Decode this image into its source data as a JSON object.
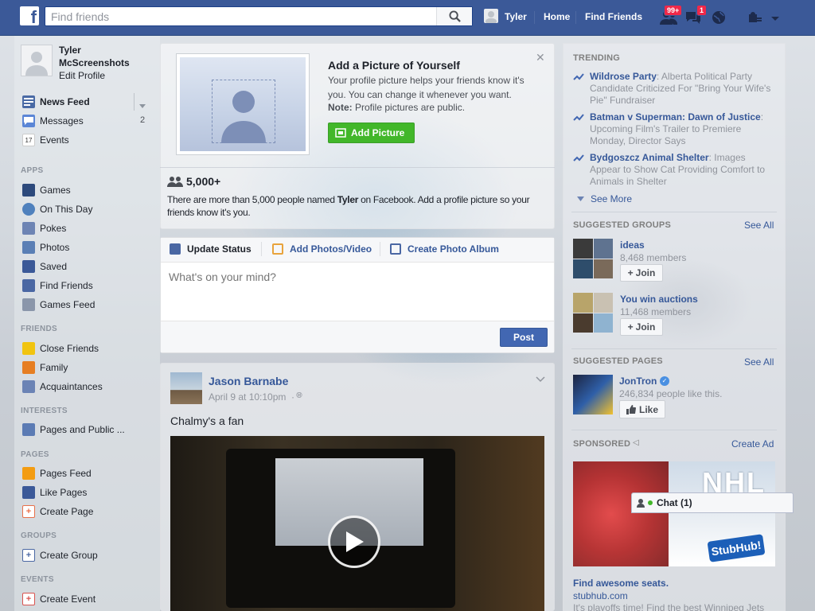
{
  "topbar": {
    "search_placeholder": "Find friends",
    "user_name": "Tyler",
    "home": "Home",
    "find_friends": "Find Friends",
    "friend_requests_badge": "99+",
    "messages_badge": "1"
  },
  "sidebar": {
    "first_name": "Tyler",
    "last_name": "McScreenshots",
    "edit_profile": "Edit Profile",
    "favorites": [
      {
        "label": "News Feed",
        "count": ""
      },
      {
        "label": "Messages",
        "count": "2"
      },
      {
        "label": "Events",
        "count": ""
      }
    ],
    "apps_header": "APPS",
    "apps": [
      "Games",
      "On This Day",
      "Pokes",
      "Photos",
      "Saved",
      "Find Friends",
      "Games Feed"
    ],
    "friends_header": "FRIENDS",
    "friends": [
      "Close Friends",
      "Family",
      "Acquaintances"
    ],
    "interests_header": "INTERESTS",
    "interests": [
      "Pages and Public ..."
    ],
    "pages_header": "PAGES",
    "pages": [
      "Pages Feed",
      "Like Pages",
      "Create Page"
    ],
    "groups_header": "GROUPS",
    "groups": [
      "Create Group"
    ],
    "events_header": "EVENTS",
    "events": [
      "Create Event"
    ]
  },
  "profile_prompt": {
    "title": "Add a Picture of Yourself",
    "body": "Your profile picture helps your friends know it's you. You can change it whenever you want.",
    "note_label": "Note:",
    "note_text": " Profile pictures are public.",
    "button": "Add Picture",
    "count": "5,000+",
    "desc_before": "There are more than 5,000 people named ",
    "desc_name": "Tyler",
    "desc_after": " on Facebook. Add a profile picture so your friends know it's you."
  },
  "composer": {
    "tabs": [
      "Update Status",
      "Add Photos/Video",
      "Create Photo Album"
    ],
    "placeholder": "What's on your mind?",
    "post": "Post"
  },
  "post": {
    "author": "Jason Barnabe",
    "time": "April 9 at 10:10pm",
    "dot": "·",
    "text": "Chalmy's a fan"
  },
  "right": {
    "trending_header": "TRENDING",
    "trending": [
      {
        "title": "Wildrose Party",
        "desc": ": Alberta Political Party Candidate Criticized For \"Bring Your Wife's Pie\" Fundraiser"
      },
      {
        "title": "Batman v Superman: Dawn of Justice",
        "desc": ": Upcoming Film's Trailer to Premiere Monday, Director Says"
      },
      {
        "title": "Bydgoszcz Animal Shelter",
        "desc": ": Images Appear to Show Cat Providing Comfort to Animals in Shelter"
      }
    ],
    "see_more": "See More",
    "groups_header": "SUGGESTED GROUPS",
    "see_all": "See All",
    "groups": [
      {
        "name": "ideas",
        "members": "8,468 members",
        "join": "Join"
      },
      {
        "name": "You win auctions",
        "members": "11,468 members",
        "join": "Join"
      }
    ],
    "pages_header": "SUGGESTED PAGES",
    "page": {
      "name": "JonTron",
      "likes": "246,834 people like this.",
      "like": "Like"
    },
    "sponsored_header": "SPONSORED",
    "create_ad": "Create Ad",
    "ad": {
      "banner": "NHL",
      "brand": "StubHub!",
      "title": "Find awesome seats.",
      "url": "stubhub.com",
      "text": "It's playoffs time! Find the best Winnipeg Jets"
    }
  },
  "chat": {
    "label": "Chat (1)"
  }
}
